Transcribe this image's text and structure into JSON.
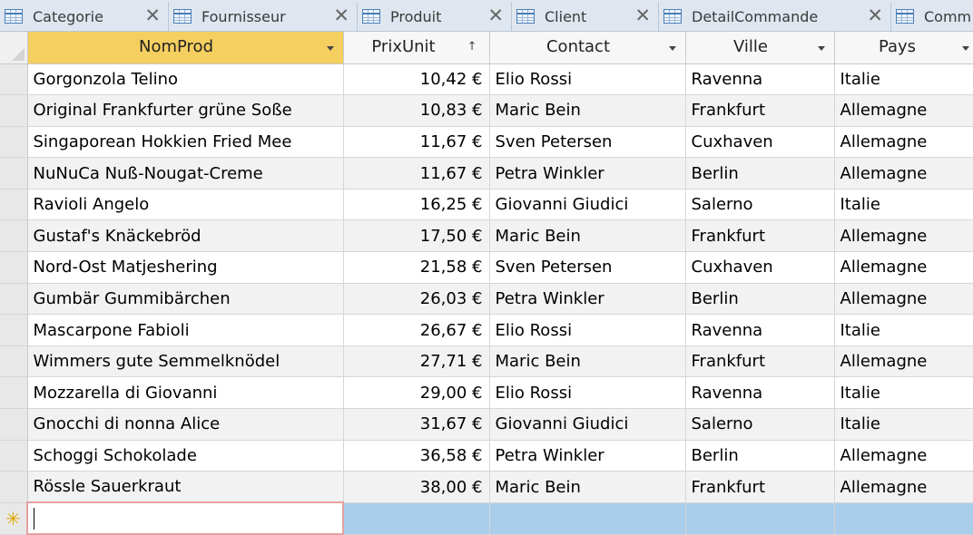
{
  "tabs": [
    {
      "label": "Categorie",
      "close": "✕",
      "icon": "table-icon"
    },
    {
      "label": "Fournisseur",
      "close": "✕",
      "icon": "table-icon"
    },
    {
      "label": "Produit",
      "close": "✕",
      "icon": "table-icon"
    },
    {
      "label": "Client",
      "close": "✕",
      "icon": "table-icon"
    },
    {
      "label": "DetailCommande",
      "close": "✕",
      "icon": "table-icon"
    },
    {
      "label": "Comm",
      "close": "",
      "icon": "table-icon"
    }
  ],
  "grid": {
    "columns": [
      {
        "label": "NomProd",
        "indicator": "dropdown"
      },
      {
        "label": "PrixUnit",
        "indicator": "sort-ascending"
      },
      {
        "label": "Contact",
        "indicator": "dropdown"
      },
      {
        "label": "Ville",
        "indicator": "dropdown"
      },
      {
        "label": "Pays",
        "indicator": "dropdown"
      }
    ],
    "rows": [
      [
        "Gorgonzola Telino",
        "10,42 €",
        "Elio Rossi",
        "Ravenna",
        "Italie"
      ],
      [
        "Original Frankfurter grüne Soße",
        "10,83 €",
        "Maric Bein",
        "Frankfurt",
        "Allemagne"
      ],
      [
        "Singaporean Hokkien Fried Mee",
        "11,67 €",
        "Sven Petersen",
        "Cuxhaven",
        "Allemagne"
      ],
      [
        "NuNuCa Nuß-Nougat-Creme",
        "11,67 €",
        "Petra Winkler",
        "Berlin",
        "Allemagne"
      ],
      [
        "Ravioli Angelo",
        "16,25 €",
        "Giovanni Giudici",
        "Salerno",
        "Italie"
      ],
      [
        "Gustaf's Knäckebröd",
        "17,50 €",
        "Maric Bein",
        "Frankfurt",
        "Allemagne"
      ],
      [
        "Nord-Ost Matjeshering",
        "21,58 €",
        "Sven Petersen",
        "Cuxhaven",
        "Allemagne"
      ],
      [
        "Gumbär Gummibärchen",
        "26,03 €",
        "Petra Winkler",
        "Berlin",
        "Allemagne"
      ],
      [
        "Mascarpone Fabioli",
        "26,67 €",
        "Elio Rossi",
        "Ravenna",
        "Italie"
      ],
      [
        "Wimmers gute Semmelknödel",
        "27,71 €",
        "Maric Bein",
        "Frankfurt",
        "Allemagne"
      ],
      [
        "Mozzarella di Giovanni",
        "29,00 €",
        "Elio Rossi",
        "Ravenna",
        "Italie"
      ],
      [
        "Gnocchi di nonna Alice",
        "31,67 €",
        "Giovanni Giudici",
        "Salerno",
        "Italie"
      ],
      [
        "Schoggi Schokolade",
        "36,58 €",
        "Petra Winkler",
        "Berlin",
        "Allemagne"
      ],
      [
        "Rössle Sauerkraut",
        "38,00 €",
        "Maric Bein",
        "Frankfurt",
        "Allemagne"
      ]
    ],
    "new_record_marker": "✳"
  },
  "colors": {
    "active_header": "#f5cf5f",
    "new_row": "#a9cdea",
    "alt_row": "#f2f2f2"
  }
}
